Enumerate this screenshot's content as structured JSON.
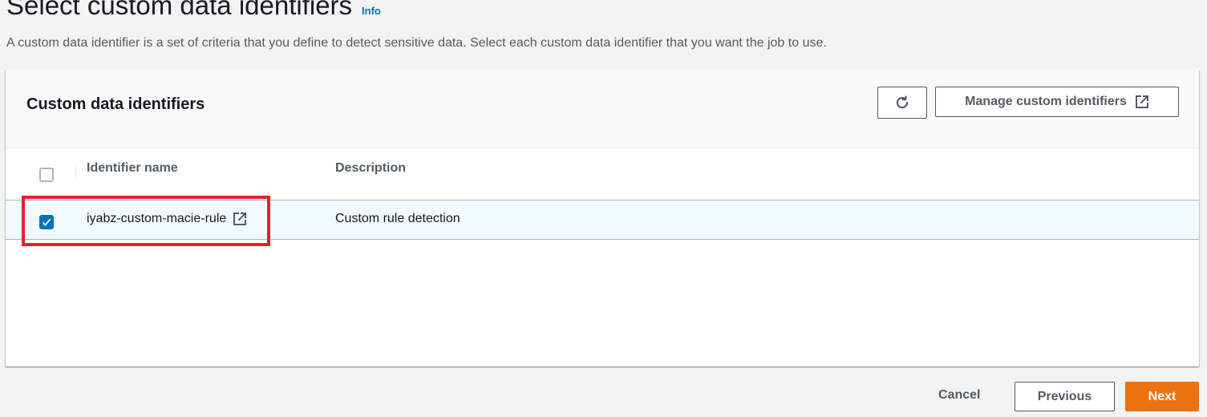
{
  "page": {
    "title": "Select custom data identifiers",
    "info_link": "Info",
    "description": "A custom data identifier is a set of criteria that you define to detect sensitive data. Select each custom data identifier that you want the job to use."
  },
  "panel": {
    "title": "Custom data identifiers",
    "refresh_icon": "refresh-icon",
    "manage_label": "Manage custom identifiers",
    "external_icon": "external-link-icon"
  },
  "table": {
    "columns": [
      "Identifier name",
      "Description"
    ],
    "rows": [
      {
        "name": "iyabz-custom-macie-rule",
        "description": "Custom rule detection",
        "selected": true
      }
    ]
  },
  "footer": {
    "cancel_label": "Cancel",
    "previous_label": "Previous",
    "next_label": "Next"
  },
  "colors": {
    "accent": "#0073bb",
    "primary_button": "#ec7211",
    "highlight": "#e0232e"
  }
}
